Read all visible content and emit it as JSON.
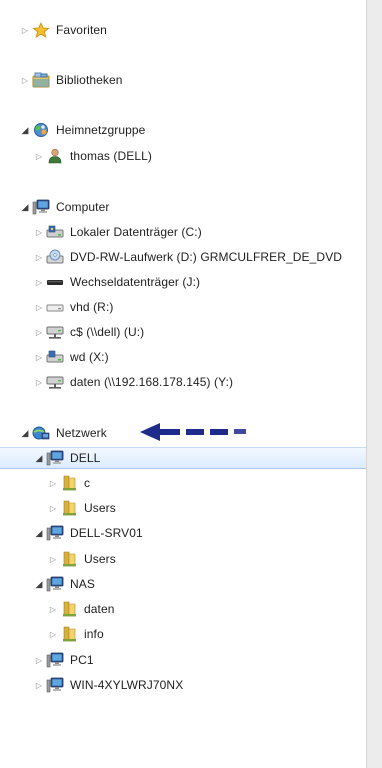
{
  "tree": {
    "favorites": "Favoriten",
    "libraries": "Bibliotheken",
    "homegroup": "Heimnetzgruppe",
    "homegroup_user": "thomas (DELL)",
    "computer": "Computer",
    "drive_c": "Lokaler Datenträger (C:)",
    "drive_d": "DVD-RW-Laufwerk (D:) GRMCULFRER_DE_DVD",
    "drive_j": "Wechseldatenträger (J:)",
    "drive_r": "vhd (R:)",
    "drive_u": "c$ (\\\\dell) (U:)",
    "drive_x": "wd (X:)",
    "drive_y": "daten (\\\\192.168.178.145) (Y:)",
    "network": "Netzwerk",
    "net_dell": "DELL",
    "net_dell_c": "c",
    "net_dell_users": "Users",
    "net_srv": "DELL-SRV01",
    "net_srv_users": "Users",
    "net_nas": "NAS",
    "net_nas_daten": "daten",
    "net_nas_info": "info",
    "net_pc1": "PC1",
    "net_win": "WIN-4XYLWRJ70NX"
  },
  "colors": {
    "selection": "#dcebfc",
    "annotation_arrow": "#1e2a8c",
    "folder": "#e8c24a"
  },
  "icons": {
    "favorites": "star-icon",
    "libraries": "library-icon",
    "homegroup": "homegroup-icon",
    "user": "user-icon",
    "computer": "computer-icon",
    "drive": "drive-icon",
    "network": "network-icon",
    "folder": "folder-icon"
  }
}
